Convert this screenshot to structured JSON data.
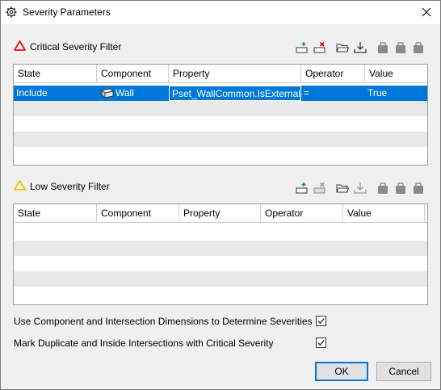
{
  "window": {
    "title": "Severity Parameters",
    "close_icon": "close-icon",
    "title_icon": "gear-icon"
  },
  "critical": {
    "title": "Critical Severity Filter",
    "icon": "red-triangle-icon",
    "columns": [
      "State",
      "Component",
      "Property",
      "Operator",
      "Value"
    ],
    "rows": [
      {
        "state": "Include",
        "component": "Wall",
        "property": "Pset_WallCommon.IsExternal",
        "operator": "=",
        "value": "True",
        "selected": true
      }
    ]
  },
  "low": {
    "title": "Low Severity Filter",
    "icon": "yellow-triangle-icon",
    "columns": [
      "State",
      "Component",
      "Property",
      "Operator",
      "Value"
    ],
    "rows": []
  },
  "options": {
    "use_dimensions_label": "Use Component and Intersection Dimensions to Determine Severities",
    "use_dimensions_checked": true,
    "mark_duplicates_label": "Mark Duplicate and Inside Intersections with Critical Severity",
    "mark_duplicates_checked": true
  },
  "buttons": {
    "ok": "OK",
    "cancel": "Cancel"
  },
  "colors": {
    "selection": "#0078d7",
    "critical_icon": "#e81123",
    "low_icon": "#f2c200"
  }
}
